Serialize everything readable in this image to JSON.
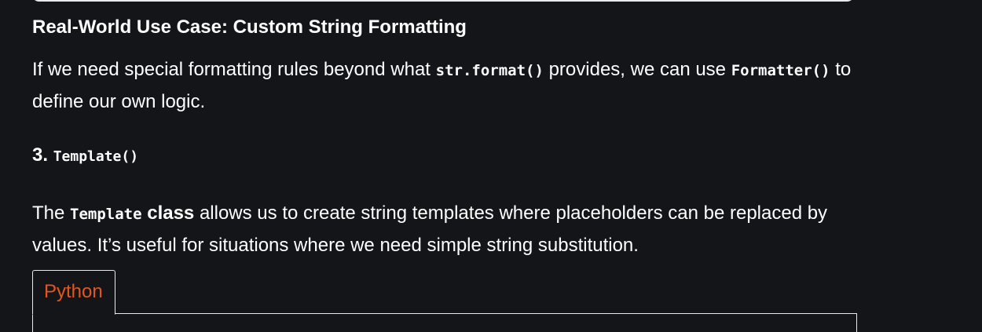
{
  "sections": {
    "use_case_heading": "Real-World Use Case: Custom String Formatting",
    "formatter_paragraph": {
      "text_1": "If we need special formatting rules beyond what ",
      "code_1": "str.format()",
      "text_2": " provides, we can use ",
      "code_2": "Formatter()",
      "text_3": " to define our own logic."
    },
    "template_heading": {
      "number": "3.",
      "code": "Template()"
    },
    "template_paragraph": {
      "text_1": "The ",
      "code_1": "Template",
      "bold_1": " class",
      "text_2": " allows us to create string templates where placeholders can be replaced by values. It’s useful for situations where we need simple string substitution."
    }
  },
  "code_block": {
    "tab_label": "Python",
    "tab_color": "#e4561e"
  },
  "colors": {
    "background": "#141519",
    "text": "#ffffff",
    "border": "#e9eaec"
  }
}
